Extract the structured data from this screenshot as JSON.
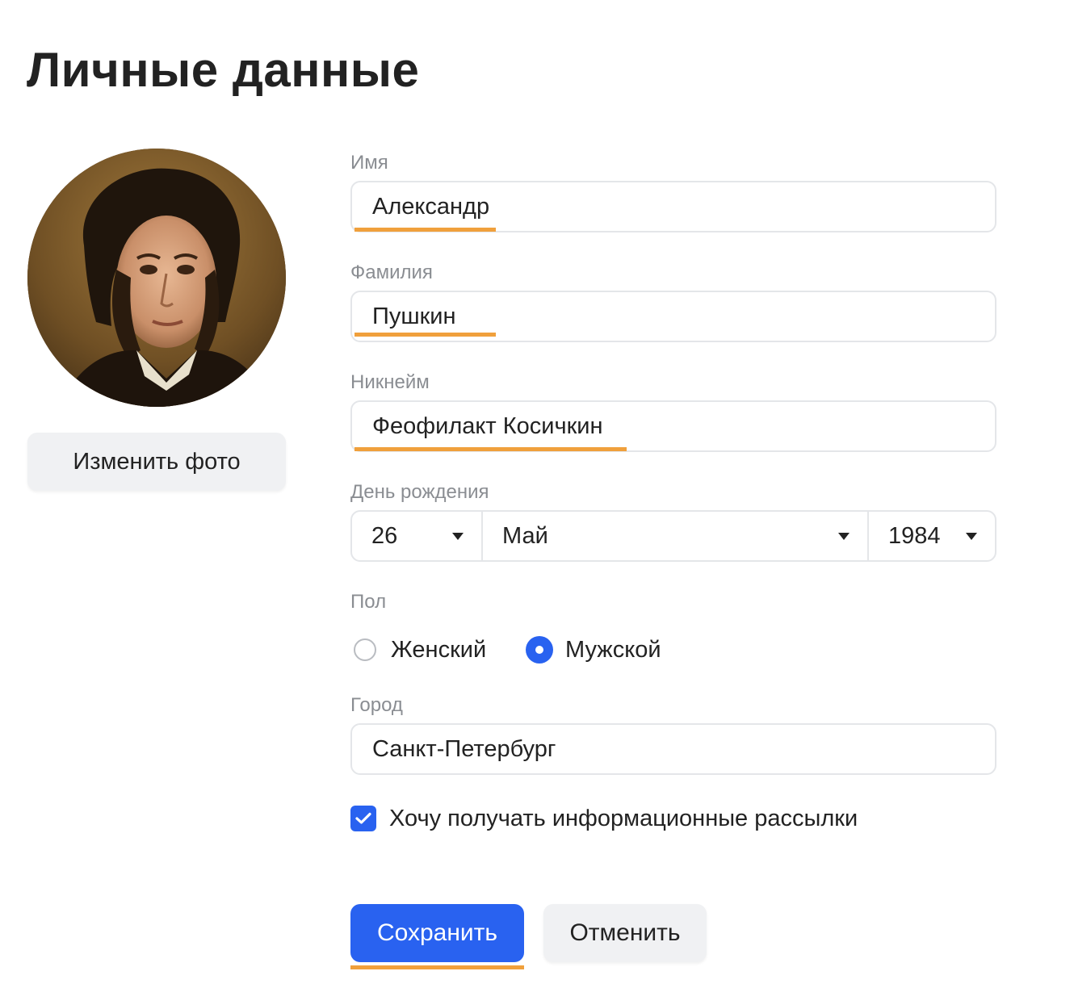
{
  "page": {
    "title": "Личные данные"
  },
  "photo": {
    "change_label": "Изменить фото"
  },
  "form": {
    "first_name": {
      "label": "Имя",
      "value": "Александр"
    },
    "last_name": {
      "label": "Фамилия",
      "value": "Пушкин"
    },
    "nickname": {
      "label": "Никнейм",
      "value": "Феофилакт Косичкин"
    },
    "birthday": {
      "label": "День рождения",
      "day": "26",
      "month": "Май",
      "year": "1984"
    },
    "gender": {
      "label": "Пол",
      "options": [
        {
          "label": "Женский",
          "checked": false
        },
        {
          "label": "Мужской",
          "checked": true
        }
      ]
    },
    "city": {
      "label": "Город",
      "value": "Санкт-Петербург"
    },
    "newsletter": {
      "label": "Хочу получать информационные рассылки",
      "checked": true
    }
  },
  "actions": {
    "save_label": "Сохранить",
    "cancel_label": "Отменить"
  },
  "colors": {
    "accent": "#2962f0",
    "highlight_underline": "#f0a03c",
    "label_gray": "#8a8d92",
    "secondary_button": "#f0f1f3"
  },
  "icons": {
    "dropdown": "caret-down-icon",
    "checkbox": "checkmark-icon"
  }
}
